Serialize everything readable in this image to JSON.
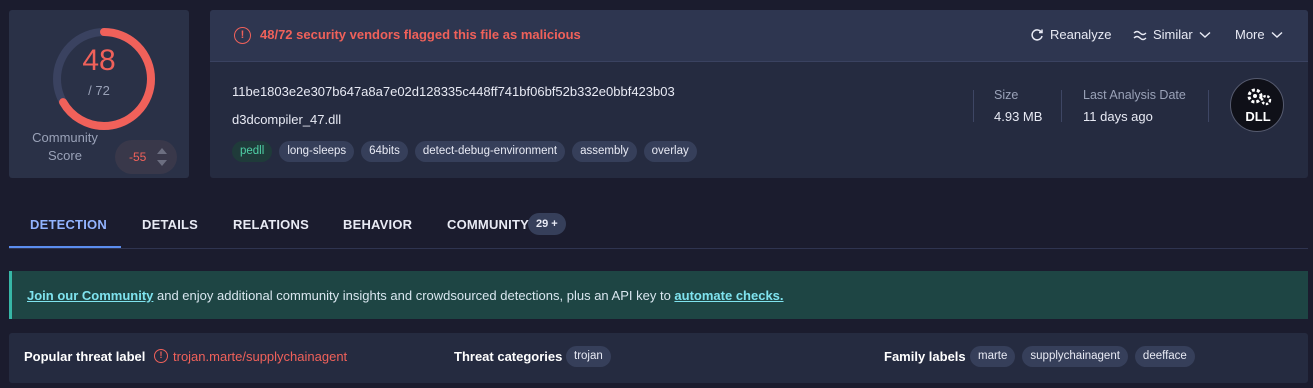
{
  "score": {
    "detections": "48",
    "total": "/ 72",
    "detected_fraction": 0.667,
    "community_label": "Community Score",
    "community_value": "-55"
  },
  "alert": {
    "text": "48/72 security vendors flagged this file as malicious"
  },
  "actions": {
    "reanalyze": "Reanalyze",
    "similar": "Similar",
    "more": "More"
  },
  "file": {
    "hash": "11be1803e2e307b647a8a7e02d128335c448ff741bf06bf52b332e0bbf423b03",
    "name": "d3dcompiler_47.dll",
    "tags": [
      "pedll",
      "long-sleeps",
      "64bits",
      "detect-debug-environment",
      "assembly",
      "overlay"
    ],
    "size_label": "Size",
    "size_value": "4.93 MB",
    "last_analysis_label": "Last Analysis Date",
    "last_analysis_value": "11 days ago",
    "type_badge": "DLL"
  },
  "tabs": {
    "detection": "DETECTION",
    "details": "DETAILS",
    "relations": "RELATIONS",
    "behavior": "BEHAVIOR",
    "community": "COMMUNITY",
    "community_count": "29 +"
  },
  "banner": {
    "link1": "Join our Community",
    "middle": " and enjoy additional community insights and crowdsourced detections, plus an API key to ",
    "link2": "automate checks."
  },
  "threat": {
    "popular_label": "Popular threat label",
    "popular_value": "trojan.marte/supplychainagent",
    "categories_label": "Threat categories",
    "categories": [
      "trojan"
    ],
    "family_label": "Family labels",
    "families": [
      "marte",
      "supplychainagent",
      "deefface"
    ]
  },
  "colors": {
    "malicious": "#f0615a",
    "accent": "#5b8def",
    "background": "#1b1c2e"
  }
}
